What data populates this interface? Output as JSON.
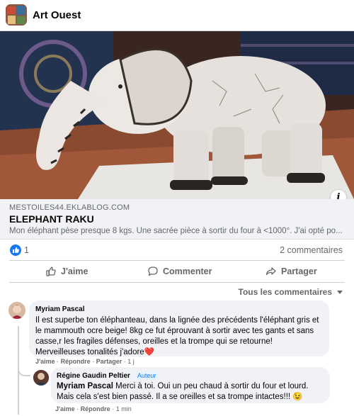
{
  "page": {
    "name": "Art Ouest"
  },
  "link": {
    "domain": "MESTOILES44.EKLABLOG.COM",
    "title": "ELEPHANT RAKU",
    "description": "Mon éléphant pèse presque 8 kgs. Une sacrée pièce à sortir du four à <1000°. J'ai opté po..."
  },
  "reactions": {
    "likes": "1",
    "comments": "2 commentaires"
  },
  "actions": {
    "like": "J'aime",
    "comment": "Commenter",
    "share": "Partager"
  },
  "sort_label": "Tous les commentaires",
  "comments": [
    {
      "author": "Myriam Pascal",
      "text": "Il est superbe ton éléphanteau, dans la lignée des précédents l'éléphant gris et le mammouth ocre beige! 8kg ce fut éprouvant à sortir avec tes gants et sans casse,r les fragiles défenses, oreilles et la trompe qui se retourne! Merveilleuses tonalités j'adore",
      "emoji": "❤️",
      "like": "J'aime",
      "reply": "Répondre",
      "share": "Partager",
      "time": "1 j"
    }
  ],
  "reply": {
    "author": "Régine Gaudin Peltier",
    "badge": "Auteur",
    "mention": "Myriam Pascal",
    "text": " Merci à toi. Oui un peu chaud à sortir du four et lourd. Mais cela s'est bien passé. Il a se oreilles et sa trompe intactes!!! ",
    "emoji": "😉",
    "like": "J'aime",
    "reply": "Répondre",
    "time": "1 min"
  },
  "colors": {
    "accent": "#1877f2",
    "secondary_text": "#65676b",
    "bubble": "#f0f2f5"
  }
}
